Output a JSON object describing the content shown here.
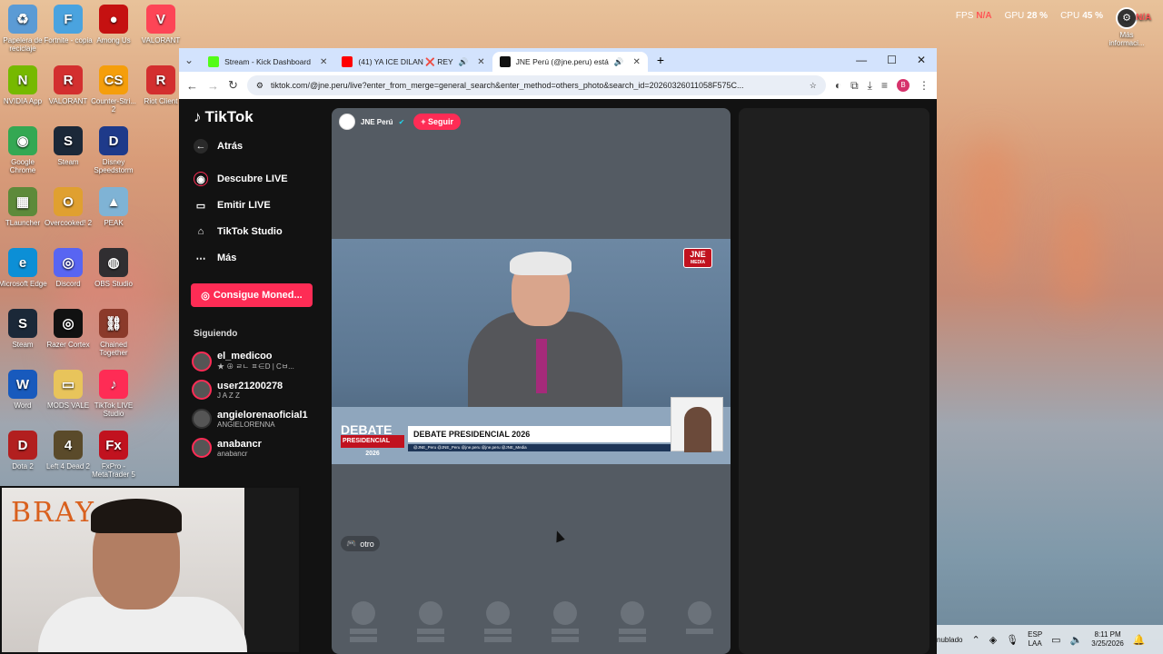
{
  "desktop": {
    "icons": [
      {
        "label": "Papelera de reciclaje",
        "color": "#5b9bd5",
        "glyph": "♻"
      },
      {
        "label": "Fortnite - copia",
        "color": "#4aa3df",
        "glyph": "F"
      },
      {
        "label": "Among Us",
        "color": "#c51111",
        "glyph": "●"
      },
      {
        "label": "VALORANT",
        "color": "#fd4556",
        "glyph": "V"
      },
      {
        "label": "NVIDIA App",
        "color": "#76b900",
        "glyph": "N"
      },
      {
        "label": "VALORANT",
        "color": "#d32f2f",
        "glyph": "R"
      },
      {
        "label": "Counter-Stri... 2",
        "color": "#f59e0b",
        "glyph": "CS"
      },
      {
        "label": "Riot Client",
        "color": "#d32f2f",
        "glyph": "R"
      },
      {
        "label": "Google Chrome",
        "color": "#34a853",
        "glyph": "◉"
      },
      {
        "label": "Steam",
        "color": "#1b2838",
        "glyph": "S"
      },
      {
        "label": "Disney Speedstorm",
        "color": "#1e3a8a",
        "glyph": "D"
      },
      {
        "label": "TLauncher",
        "color": "#5d8a3a",
        "glyph": "▦"
      },
      {
        "label": "Overcooked! 2",
        "color": "#e0a030",
        "glyph": "O"
      },
      {
        "label": "PEAK",
        "color": "#7fb3d5",
        "glyph": "▲"
      },
      {
        "label": "Microsoft Edge",
        "color": "#0c8fd6",
        "glyph": "e"
      },
      {
        "label": "Discord",
        "color": "#5865f2",
        "glyph": "◎"
      },
      {
        "label": "OBS Studio",
        "color": "#302e31",
        "glyph": "◍"
      },
      {
        "label": "Steam",
        "color": "#1b2838",
        "glyph": "S"
      },
      {
        "label": "Razer Cortex",
        "color": "#111",
        "glyph": "◎"
      },
      {
        "label": "Chained Together",
        "color": "#8b3a2a",
        "glyph": "⛓"
      },
      {
        "label": "Word",
        "color": "#185abd",
        "glyph": "W"
      },
      {
        "label": "MODS VALE",
        "color": "#e8c45b",
        "glyph": "▭"
      },
      {
        "label": "TikTok LIVE Studio",
        "color": "#fe2c55",
        "glyph": "♪"
      },
      {
        "label": "Dota 2",
        "color": "#b21f1f",
        "glyph": "D"
      },
      {
        "label": "Left 4 Dead 2",
        "color": "#5a4a2a",
        "glyph": "4"
      },
      {
        "label": "FxPro - MetaTrader 5",
        "color": "#c1121f",
        "glyph": "Fx"
      }
    ]
  },
  "overlay": {
    "fps_label": "FPS",
    "fps_value": "N/A",
    "gpu_label": "GPU",
    "gpu_value": "28 %",
    "cpu_label": "CPU",
    "cpu_value": "45 %",
    "more_value": "N/A",
    "more_label": "Más informaci..."
  },
  "browser": {
    "tabs": [
      {
        "title": "Stream - Kick Dashboard",
        "color": "#53fc18"
      },
      {
        "title": "(41) YA ICE DILAN ❌ REY",
        "color": "#ff0000"
      },
      {
        "title": "JNE Perú (@jne.peru) está",
        "color": "#111111"
      }
    ],
    "new_tab": "+",
    "url": "tiktok.com/@jne.peru/live?enter_from_merge=general_search&enter_method=others_photo&search_id=20260326011058F575C...",
    "profile_initial": "B"
  },
  "tiktok": {
    "logo": "TikTok",
    "back": "Atrás",
    "nav": [
      {
        "label": "Descubre LIVE",
        "icon": "live-icon"
      },
      {
        "label": "Emitir LIVE",
        "icon": "camera-icon"
      },
      {
        "label": "TikTok Studio",
        "icon": "studio-icon"
      },
      {
        "label": "Más",
        "icon": "more-icon"
      }
    ],
    "coins_button": "Consigue Moned...",
    "following_label": "Siguiendo",
    "following": [
      {
        "name": "el_medicoo",
        "sub": "★ ⊕ ㄹㄴ ㅍ∈D | Cㅂ..."
      },
      {
        "name": "user21200278",
        "sub": "J A Z Z"
      },
      {
        "name": "angielorenaoficial1",
        "sub": "ANGIELORENNA"
      },
      {
        "name": "anabancr",
        "sub": "anabancr"
      }
    ]
  },
  "player": {
    "channel": "JNE Perú",
    "follow_button": "+ Seguir",
    "watermark_top": "JNE",
    "watermark_bottom": "MEDIA",
    "lt_debate": "DEBATE",
    "lt_presidencial": "PRESIDENCIAL",
    "lt_year": "2026",
    "lower_third": "DEBATE PRESIDENCIAL 2026",
    "lower_third_sub": "@JNE_Peru    @JNE_Peru    @jne.peru    @jne.peru    @JNE_Media",
    "category": "otro"
  },
  "webcam": {
    "overlay_text": "BRAY"
  },
  "taskbar": {
    "weather": "nublado",
    "lang_top": "ESP",
    "lang_bottom": "LAA",
    "time": "8:11 PM",
    "date": "3/25/2026"
  }
}
